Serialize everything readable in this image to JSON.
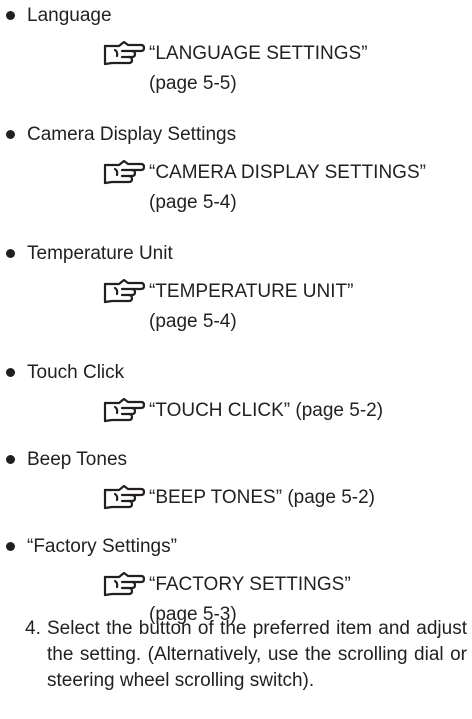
{
  "icon_name": "pointing-hand-reference-icon",
  "items": [
    {
      "label": "Language",
      "ref_title": "“LANGUAGE SETTINGS”",
      "ref_page": "(page 5-5)"
    },
    {
      "label": "Camera Display Settings",
      "ref_title": "“CAMERA DISPLAY SETTINGS”",
      "ref_page": "(page 5-4)"
    },
    {
      "label": "Temperature Unit",
      "ref_title": "“TEMPERATURE UNIT”",
      "ref_page": "(page 5-4)"
    },
    {
      "label": "Touch Click",
      "ref_title": "“TOUCH CLICK” (page 5-2)",
      "ref_page": ""
    },
    {
      "label": "Beep Tones",
      "ref_title": "“BEEP TONES” (page 5-2)",
      "ref_page": ""
    },
    {
      "label": "“Factory Settings”",
      "ref_title": "“FACTORY SETTINGS”",
      "ref_page": "(page 5-3)"
    }
  ],
  "step": {
    "number": "4.",
    "text": "Select the button of the preferred item and adjust the setting. (Alternatively, use the scrolling dial or steering wheel scrolling switch)."
  }
}
